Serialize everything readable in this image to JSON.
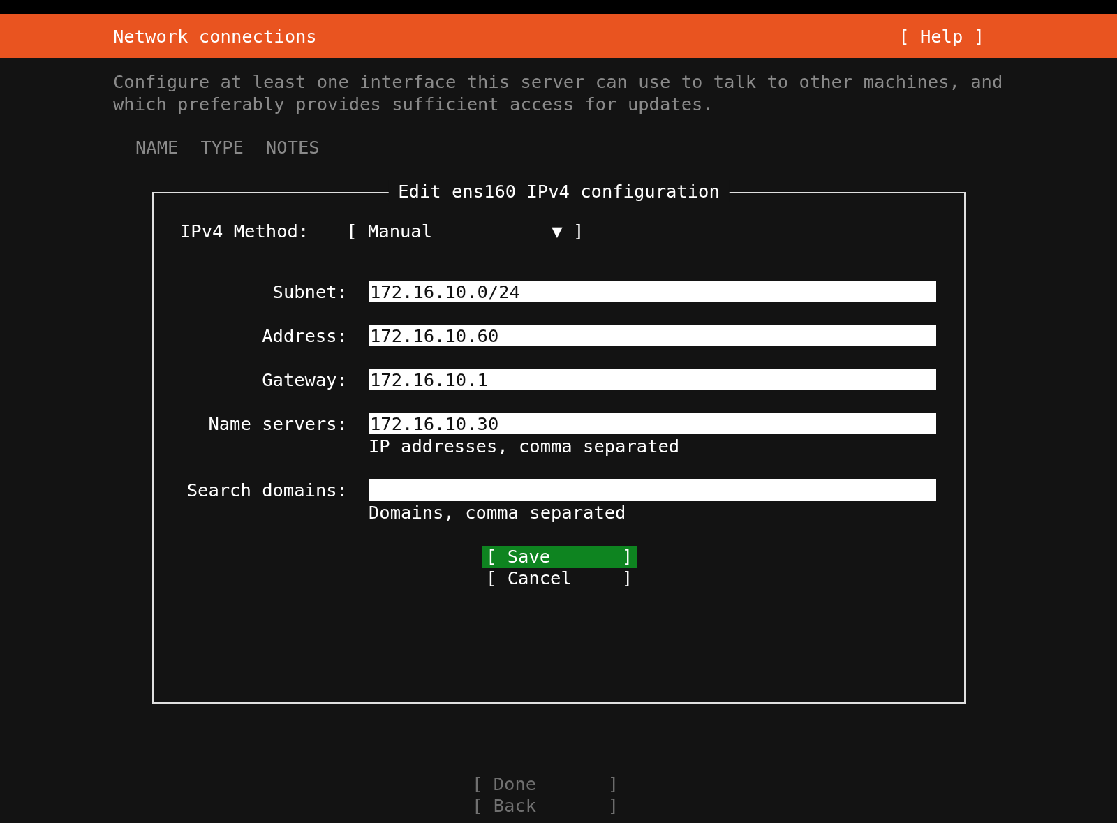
{
  "header": {
    "title": "Network connections",
    "help": "[ Help ]"
  },
  "description": "Configure at least one interface this server can use to talk to other machines, and which preferably provides sufficient access for updates.",
  "columns": [
    "NAME",
    "TYPE",
    "NOTES"
  ],
  "dialog": {
    "title": "Edit ens160 IPv4 configuration",
    "method": {
      "label": "IPv4 Method:",
      "open": "[",
      "value": "Manual",
      "arrow": "▼",
      "close": "]"
    },
    "fields": [
      {
        "label": "Subnet:",
        "value": "172.16.10.0/24"
      },
      {
        "label": "Address:",
        "value": "172.16.10.60"
      },
      {
        "label": "Gateway:",
        "value": "172.16.10.1"
      },
      {
        "label": "Name servers:",
        "value": "172.16.10.30",
        "hint": "IP addresses, comma separated"
      },
      {
        "label": "Search domains:",
        "hint": "Domains, comma separated"
      }
    ],
    "buttons": [
      {
        "open": "[",
        "label": "Save",
        "close": "]",
        "selected": true
      },
      {
        "open": "[",
        "label": "Cancel",
        "close": "]",
        "selected": false
      }
    ]
  },
  "footer_buttons": [
    {
      "open": "[",
      "label": "Done",
      "close": "]",
      "disabled": true
    },
    {
      "open": "[",
      "label": "Back",
      "close": "]",
      "disabled": true
    }
  ]
}
